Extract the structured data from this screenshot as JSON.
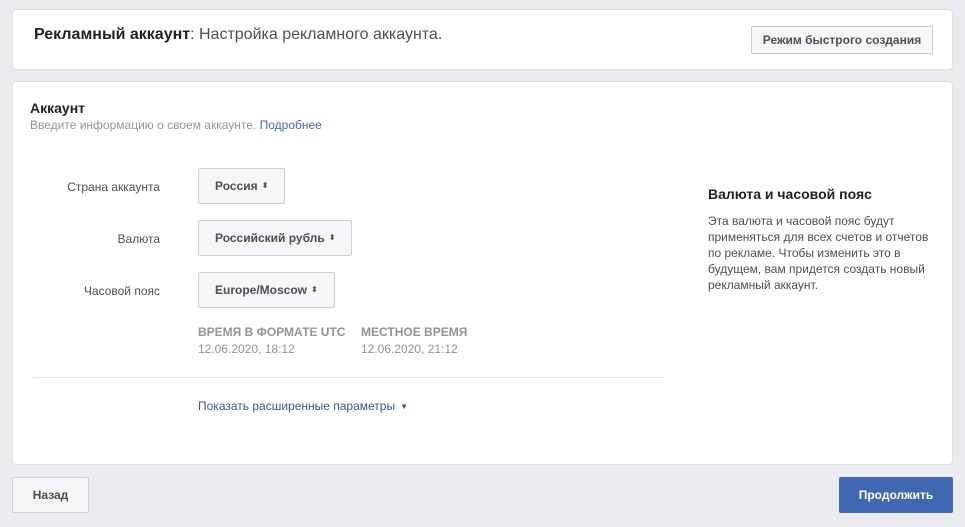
{
  "header": {
    "title_bold": "Рекламный аккаунт",
    "title_rest": ": Настройка рекламного аккаунта.",
    "quick_create_label": "Режим быстрого создания"
  },
  "account_section": {
    "title": "Аккаунт",
    "subtitle": "Введите информацию о своем аккаунте.",
    "more_link": "Подробнее"
  },
  "form": {
    "country": {
      "label": "Страна аккаунта",
      "value": "Россия",
      "arrow": "⬍"
    },
    "currency": {
      "label": "Валюта",
      "value": "Российский рубль",
      "arrow": "⬍"
    },
    "timezone": {
      "label": "Часовой пояс",
      "value": "Europe/Moscow",
      "arrow": "⬍"
    },
    "utc_time": {
      "label": "ВРЕМЯ В ФОРМАТЕ UTC",
      "value": "12.06.2020, 18:12"
    },
    "local_time": {
      "label": "МЕСТНОЕ ВРЕМЯ",
      "value": "12.06.2020, 21:12"
    },
    "advanced_link": "Показать расширенные параметры"
  },
  "sidebar": {
    "title": "Валюта и часовой пояс",
    "text": "Эта валюта и часовой пояс будут применяться для всех счетов и отчетов по рекламе. Чтобы изменить это в будущем, вам придется создать новый рекламный аккаунт."
  },
  "footer": {
    "back_label": "Назад",
    "continue_label": "Продолжить"
  },
  "colors": {
    "background": "#e9ebee",
    "primary": "#4267b2",
    "link": "#365899"
  },
  "icons": {
    "select_arrow": "sort-arrows-icon",
    "expand": "caret-down-icon"
  }
}
